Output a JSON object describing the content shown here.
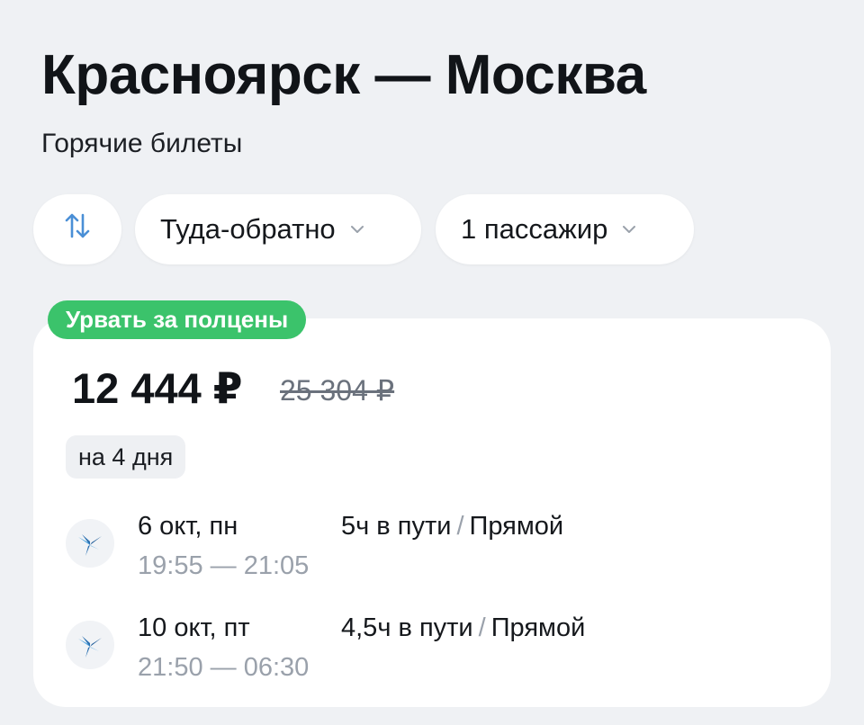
{
  "header": {
    "title": "Красноярск — Москва",
    "subtitle": "Горячие билеты"
  },
  "filters": {
    "swap_icon": "swap-vertical-icon",
    "trip_type": "Туда-обратно",
    "passengers": "1 пассажир"
  },
  "offer": {
    "badge": "Урвать за полцены",
    "price": "12 444 ₽",
    "old_price": "25 304 ₽",
    "duration": "на 4 дня",
    "segments": [
      {
        "date": "6 окт, пн",
        "depart": "19:55",
        "arrive": "21:05",
        "travel_time": "5ч в пути",
        "stops": "Прямой"
      },
      {
        "date": "10 окт, пт",
        "depart": "21:50",
        "arrive": "06:30",
        "travel_time": "4,5ч в пути",
        "stops": "Прямой"
      }
    ],
    "separator": "/",
    "time_separator": "—"
  },
  "colors": {
    "background": "#eff1f4",
    "badge": "#3bc36b",
    "muted_text": "#9aa1ab",
    "airline_logo": "#2a6fb0"
  }
}
